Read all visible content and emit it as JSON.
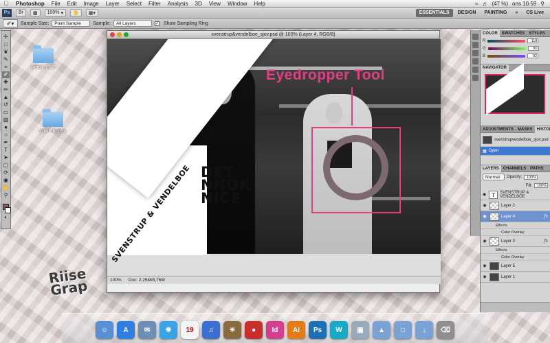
{
  "menubar": {
    "app_name": "Photoshop",
    "menus": [
      "File",
      "Edit",
      "Image",
      "Layer",
      "Select",
      "Filter",
      "Analysis",
      "3D",
      "View",
      "Window",
      "Help"
    ],
    "status": {
      "battery": "(47 %)",
      "clock": "ons 10.59"
    }
  },
  "appbar": {
    "zoom": "100%",
    "workspaces": [
      "ESSENTIALS",
      "DESIGN",
      "PAINTING"
    ],
    "active_workspace": "ESSENTIALS",
    "cs_live": "CS Live"
  },
  "options": {
    "sample_size_label": "Sample Size:",
    "sample_size_value": "Point Sample",
    "sample_label": "Sample:",
    "sample_value": "All Layers",
    "show_ring_label": "Show Sampling Ring",
    "show_ring_checked": "✓"
  },
  "desktop": {
    "icons": [
      {
        "label": "Airfoil 3.6.2"
      },
      {
        "label": "Wiki - Komfo"
      }
    ],
    "graffiti_line1": "Riise",
    "graffiti_line2": "Grap"
  },
  "document": {
    "title": "svenstrup&vendelboe_sjov.psd @ 100% (Layer 4, RGB/8)",
    "overlay_heading": "Eyedropper Tool",
    "stripe_text": "SVENSTRUP & VENDELBOE",
    "logo_lines": [
      "DET",
      "NNOK",
      "NICE"
    ],
    "zoom": "100%",
    "doc_size": "Doc: 2,25M/8,76M"
  },
  "panels": {
    "color": {
      "tabs": [
        "COLOR",
        "SWATCHES",
        "STYLES"
      ],
      "r": "118",
      "g": "80",
      "b": "92",
      "r_label": "R",
      "g_label": "G",
      "b_label": "B"
    },
    "navigator": {
      "tab": "NAVIGATOR"
    },
    "history": {
      "tabs": [
        "ADJUSTMENTS",
        "MASKS",
        "HISTORY"
      ],
      "snapshot": "svenstrupvendelboe_sjov.psd",
      "items": [
        "Open"
      ]
    },
    "layers": {
      "tabs": [
        "LAYERS",
        "CHANNELS",
        "PATHS"
      ],
      "blend_mode": "Normal",
      "opacity_label": "Opacity:",
      "opacity": "100%",
      "fill_label": "Fill:",
      "fill": "100%",
      "rows": [
        {
          "name": "SVENSTRUP & VENDELBOE",
          "kind": "text"
        },
        {
          "name": "Layer 2",
          "kind": "trans"
        },
        {
          "name": "Layer 4",
          "kind": "img",
          "fx": "fx",
          "active": true
        },
        {
          "name": "Layer 3",
          "kind": "trans",
          "fx": "fx"
        },
        {
          "name": "Layer 5",
          "kind": "img"
        },
        {
          "name": "Layer 1",
          "kind": "img"
        }
      ],
      "effects_label": "Effects",
      "color_overlay_label": "Color Overlay"
    }
  },
  "colors": {
    "accent_pink": "#e63d82",
    "foreground": "#8a5262",
    "selection_blue": "#6f93d2"
  }
}
